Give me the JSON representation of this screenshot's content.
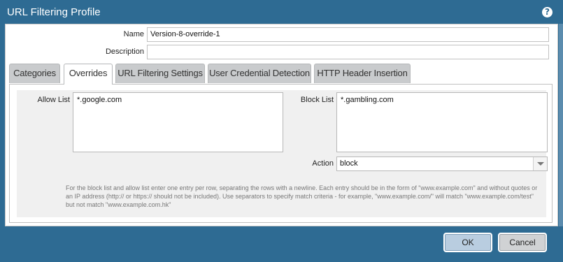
{
  "window": {
    "title": "URL Filtering Profile",
    "help_icon": "question-circle-icon"
  },
  "form": {
    "name_label": "Name",
    "name_value": "Version-8-override-1",
    "description_label": "Description",
    "description_value": ""
  },
  "tabs": [
    {
      "label": "Categories",
      "active": false
    },
    {
      "label": "Overrides",
      "active": true
    },
    {
      "label": "URL Filtering Settings",
      "active": false
    },
    {
      "label": "User Credential Detection",
      "active": false
    },
    {
      "label": "HTTP Header Insertion",
      "active": false
    }
  ],
  "overrides": {
    "allow_list_label": "Allow List",
    "allow_list_value": "*.google.com",
    "block_list_label": "Block List",
    "block_list_value": "*.gambling.com",
    "action_label": "Action",
    "action_value": "block",
    "help_text": "For the block list and allow list enter one entry per row, separating the rows with a newline. Each entry should be in the form of \"www.example.com\" and without quotes or an IP address (http:// or https:// should not be included). Use separators to specify match criteria - for example, \"www.example.com/\" will match \"www.example.com/test\" but not match \"www.example.com.hk\""
  },
  "buttons": {
    "ok_label": "OK",
    "cancel_label": "Cancel"
  },
  "colors": {
    "titlebar": "#2e6b93",
    "ok_button": "#b9cde0",
    "tab_inactive": "#c9cbcd"
  }
}
